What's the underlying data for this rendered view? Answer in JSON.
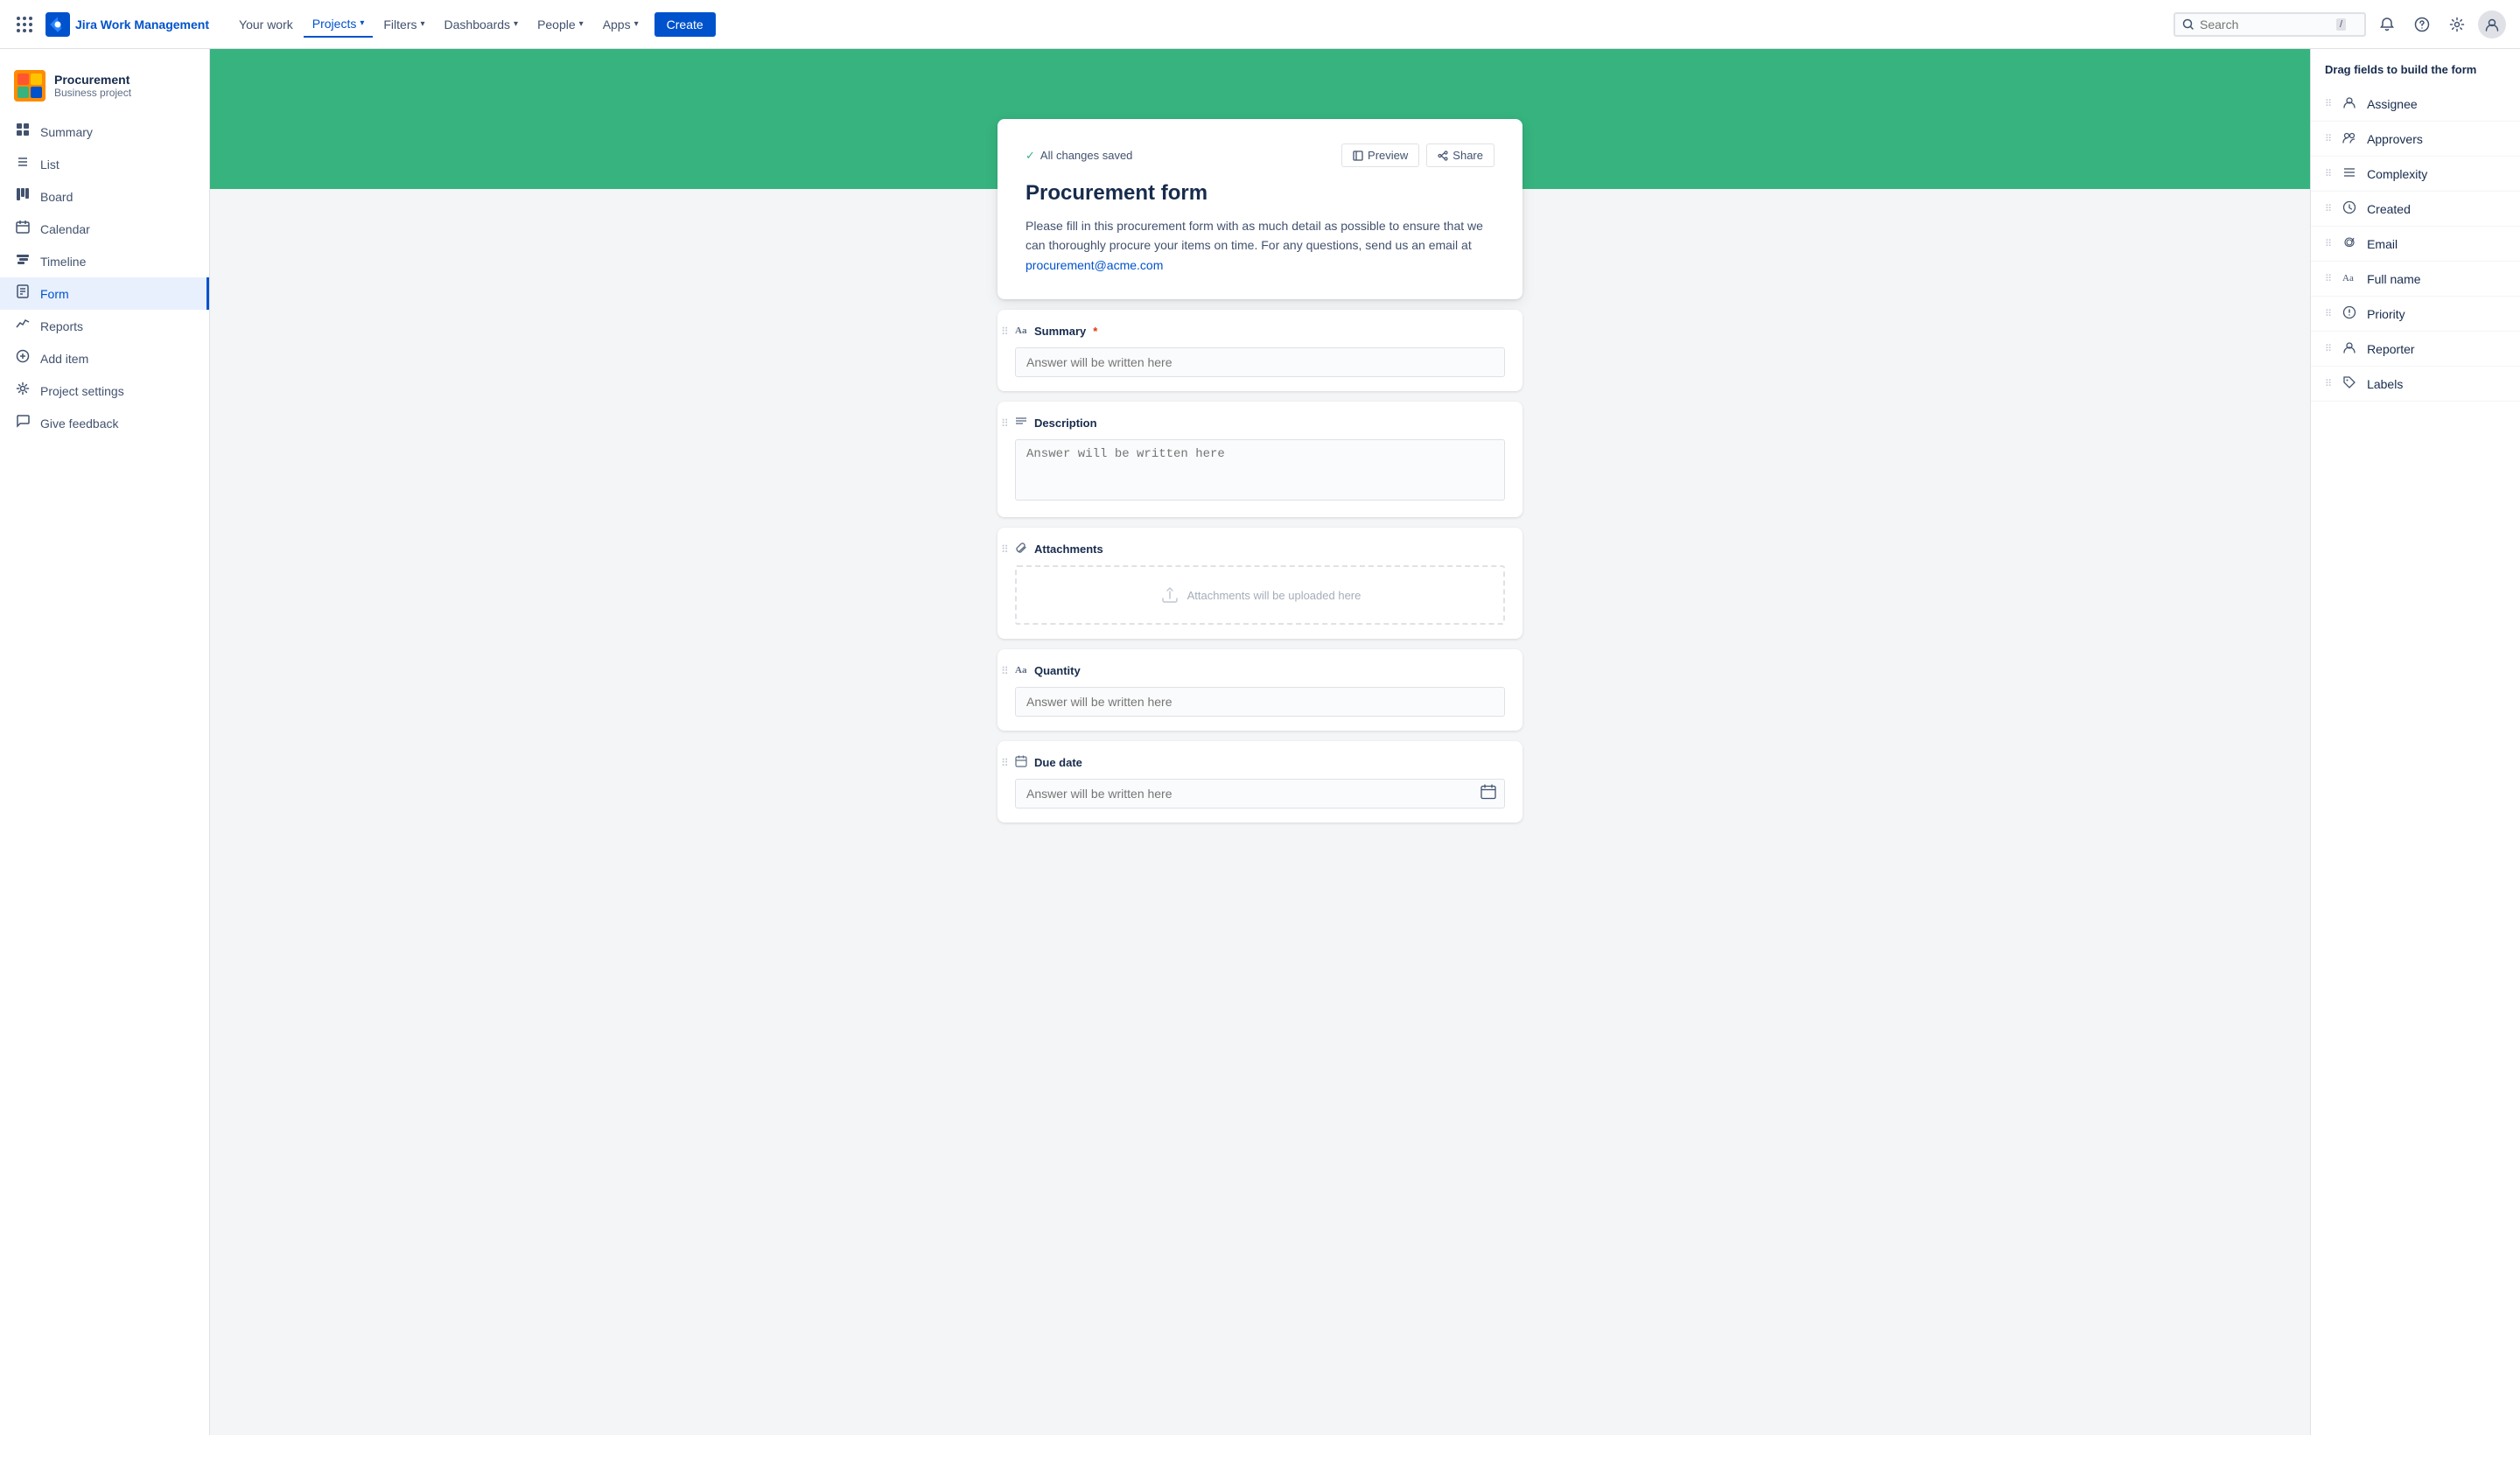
{
  "topnav": {
    "logo_text": "Jira Work Management",
    "items": [
      {
        "id": "your-work",
        "label": "Your work"
      },
      {
        "id": "projects",
        "label": "Projects",
        "active": true
      },
      {
        "id": "filters",
        "label": "Filters"
      },
      {
        "id": "dashboards",
        "label": "Dashboards"
      },
      {
        "id": "people",
        "label": "People"
      },
      {
        "id": "apps",
        "label": "Apps"
      }
    ],
    "create_label": "Create",
    "search_placeholder": "Search",
    "search_shortcut": "/"
  },
  "sidebar": {
    "project_name": "Procurement",
    "project_type": "Business project",
    "nav_items": [
      {
        "id": "summary",
        "icon": "▦",
        "label": "Summary"
      },
      {
        "id": "list",
        "icon": "☰",
        "label": "List"
      },
      {
        "id": "board",
        "icon": "⊞",
        "label": "Board"
      },
      {
        "id": "calendar",
        "icon": "📅",
        "label": "Calendar"
      },
      {
        "id": "timeline",
        "icon": "⊟",
        "label": "Timeline"
      },
      {
        "id": "form",
        "icon": "≡",
        "label": "Form",
        "active": true
      },
      {
        "id": "reports",
        "icon": "📈",
        "label": "Reports"
      },
      {
        "id": "add-item",
        "icon": "➕",
        "label": "Add item"
      },
      {
        "id": "project-settings",
        "icon": "⚙",
        "label": "Project settings"
      },
      {
        "id": "give-feedback",
        "icon": "📣",
        "label": "Give feedback"
      }
    ]
  },
  "form": {
    "saved_status": "All changes saved",
    "preview_label": "Preview",
    "share_label": "Share",
    "title": "Procurement form",
    "description": "Please fill in this procurement form with as much detail as possible to ensure that we can thoroughly procure your items on time. For any questions, send us an email at",
    "email_link": "procurement@acme.com",
    "sections": [
      {
        "id": "summary",
        "icon": "Aα",
        "label": "Summary",
        "required": true,
        "placeholder": "Answer will be written here",
        "type": "input"
      },
      {
        "id": "description",
        "icon": "≡",
        "label": "Description",
        "required": false,
        "placeholder": "Answer will be written here",
        "type": "textarea"
      },
      {
        "id": "attachments",
        "icon": "📎",
        "label": "Attachments",
        "required": false,
        "upload_text": "Attachments will be uploaded here",
        "type": "upload"
      },
      {
        "id": "quantity",
        "icon": "Aα",
        "label": "Quantity",
        "required": false,
        "placeholder": "Answer will be written here",
        "type": "input"
      },
      {
        "id": "due-date",
        "icon": "📅",
        "label": "Due date",
        "required": false,
        "placeholder": "Answer will be written here",
        "type": "date"
      }
    ]
  },
  "right_panel": {
    "title": "Drag fields to build the form",
    "fields": [
      {
        "id": "assignee",
        "icon": "👤",
        "label": "Assignee"
      },
      {
        "id": "approvers",
        "icon": "👥",
        "label": "Approvers"
      },
      {
        "id": "complexity",
        "icon": "≡",
        "label": "Complexity"
      },
      {
        "id": "created",
        "icon": "🕐",
        "label": "Created"
      },
      {
        "id": "email",
        "icon": "🔗",
        "label": "Email"
      },
      {
        "id": "full-name",
        "icon": "Aα",
        "label": "Full name"
      },
      {
        "id": "priority",
        "icon": "⊘",
        "label": "Priority"
      },
      {
        "id": "reporter",
        "icon": "👤",
        "label": "Reporter"
      },
      {
        "id": "labels",
        "icon": "🏷",
        "label": "Labels"
      }
    ]
  }
}
